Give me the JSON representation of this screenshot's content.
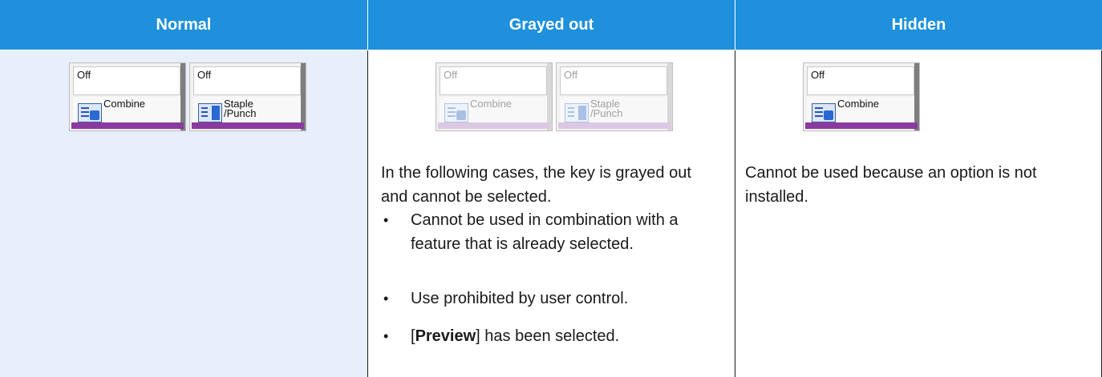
{
  "header": {
    "normal": "Normal",
    "grayed": "Grayed out",
    "hidden": "Hidden"
  },
  "keys": {
    "off": "Off",
    "combine": "Combine",
    "staple_line1": "Staple",
    "staple_line2": "/Punch"
  },
  "grayed": {
    "intro": "In the following cases, the key is grayed out and cannot be selected.",
    "bullets": [
      "Cannot be used in combination with a feature that is already selected.",
      "Use prohibited by user control.",
      "] has been selected."
    ],
    "preview_prefix": "[",
    "preview_bold": "Preview"
  },
  "hidden": {
    "text": "Cannot be used because an option is not installed."
  },
  "colors": {
    "header_blue": "#1e90dc",
    "normal_bg": "#e8eefb",
    "accent_purple": "#8a3a9e"
  }
}
